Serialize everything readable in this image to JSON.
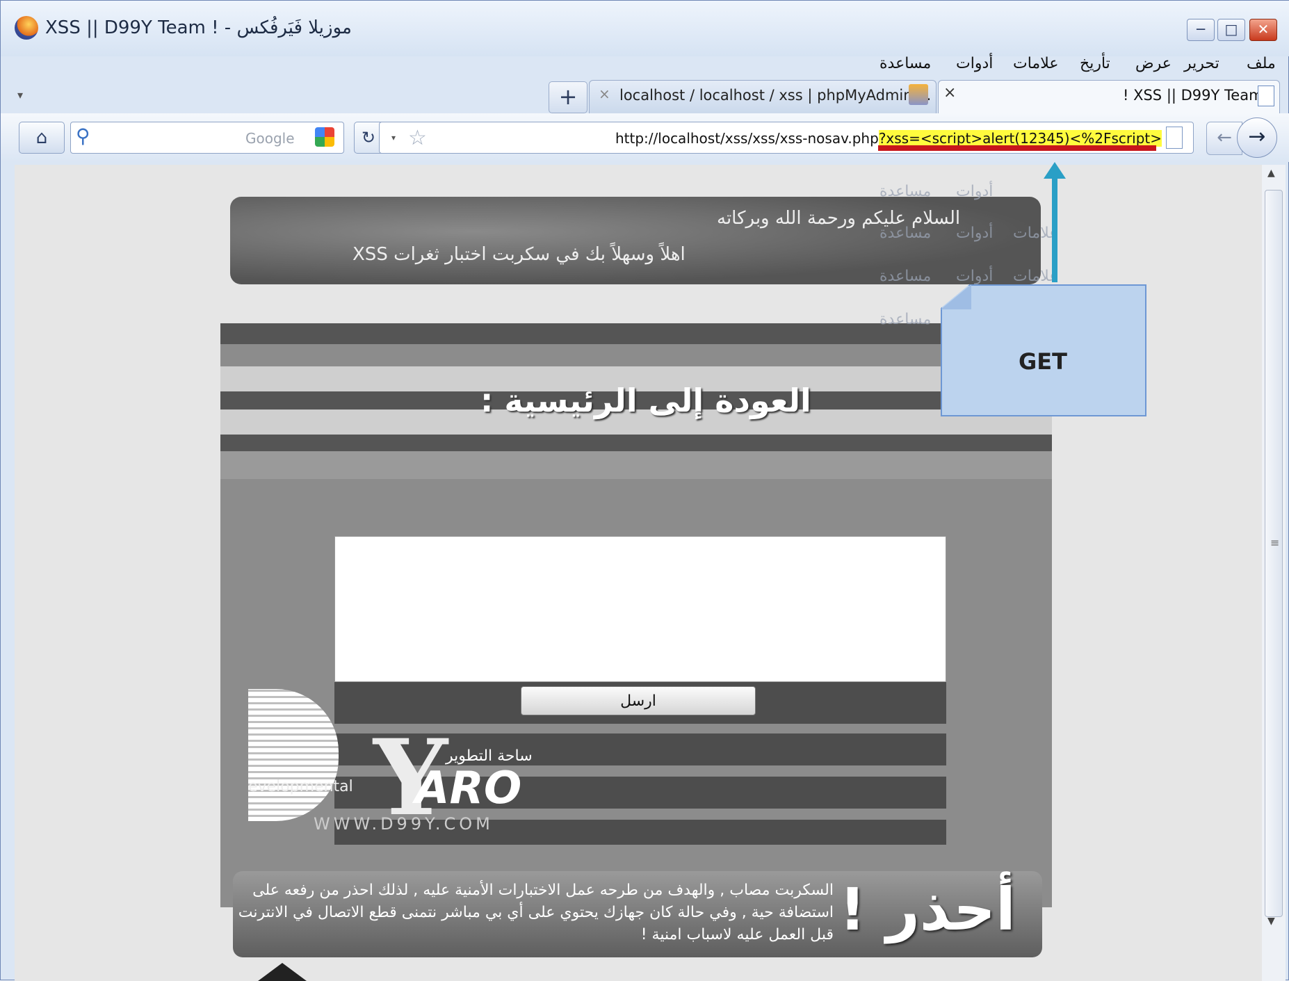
{
  "window": {
    "title": "موزيلا فَيَرفُكس - ! XSS || D99Y Team",
    "buttons": {
      "minimize": "─",
      "maximize": "□",
      "close": "✕"
    }
  },
  "menu": {
    "items": [
      "ملف",
      "تحرير",
      "عرض",
      "تأريخ",
      "علامات",
      "أدوات",
      "مساعدة"
    ]
  },
  "tabs": [
    {
      "label": "! XSS || D99Y Team",
      "active": true,
      "close": "×"
    },
    {
      "label": "localhost / localhost / xss | phpMyAdmin ...",
      "active": false,
      "close": "×"
    }
  ],
  "tabbar": {
    "new_tab": "+",
    "tab_list": "▾"
  },
  "navbar": {
    "url_base": "http://localhost/xss/xss/xss-nosav.php",
    "url_query": "?xss=<script>alert(12345)<%2Fscript>",
    "search_engine": "Google",
    "icons": {
      "home": "home-icon",
      "search": "magnifier-icon",
      "reload": "reload-icon",
      "star": "star-icon",
      "back": "back-arrow-icon",
      "forward": "forward-arrow-icon"
    }
  },
  "page": {
    "banner_line1": "السلام عليكم ورحمة الله وبركاته",
    "banner_line2": "اهلاً وسهلاً بك في سكربت اختبار ثغرات XSS",
    "home_heading": "العودة إلى الرئيسية :",
    "send_button": "ارسل",
    "logo": {
      "tagline": "ساحة التطوير",
      "aro": "ARO",
      "y": "Y",
      "dev": "evelopmental",
      "site": "WWW.D99Y.COM"
    },
    "warning_title": "أحذر !",
    "warning_text": "السكربت مصاب , والهدف من طرحه عمل الاختبارات الأمنية عليه , لذلك احذر من رفعه على استضافة حية , وفي حالة كان جهازك يحتوي على أي بي مباشر نتمنى قطع الاتصال في الانترنت قبل العمل عليه لاسباب امنية !"
  },
  "annotation": {
    "callout_label": "GET"
  },
  "colors": {
    "url_highlight": "#fffb3e",
    "underline": "#c8161b",
    "callout": "#bcd3ee",
    "arrow": "#2a9fc6"
  }
}
